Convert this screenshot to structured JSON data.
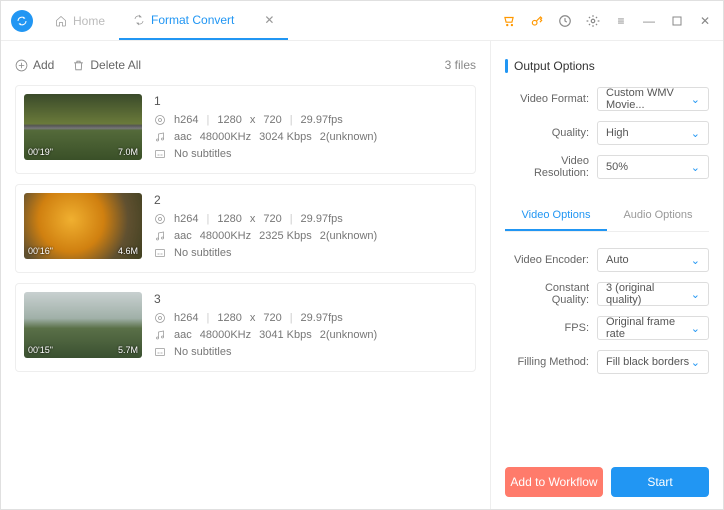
{
  "tabs": {
    "home": "Home",
    "active": "Format Convert"
  },
  "toolbar": {
    "add": "Add",
    "delete_all": "Delete All",
    "file_count": "3 files"
  },
  "files": [
    {
      "index": "1",
      "duration": "00'19\"",
      "size": "7.0M",
      "vcodec": "h264",
      "w": "1280",
      "x": "x",
      "h": "720",
      "fps": "29.97fps",
      "acodec": "aac",
      "arate": "48000KHz",
      "bitrate": "3024 Kbps",
      "ch": "2(unknown)",
      "subs": "No subtitles"
    },
    {
      "index": "2",
      "duration": "00'16\"",
      "size": "4.6M",
      "vcodec": "h264",
      "w": "1280",
      "x": "x",
      "h": "720",
      "fps": "29.97fps",
      "acodec": "aac",
      "arate": "48000KHz",
      "bitrate": "2325 Kbps",
      "ch": "2(unknown)",
      "subs": "No subtitles"
    },
    {
      "index": "3",
      "duration": "00'15\"",
      "size": "5.7M",
      "vcodec": "h264",
      "w": "1280",
      "x": "x",
      "h": "720",
      "fps": "29.97fps",
      "acodec": "aac",
      "arate": "48000KHz",
      "bitrate": "3041 Kbps",
      "ch": "2(unknown)",
      "subs": "No subtitles"
    }
  ],
  "output": {
    "title": "Output Options",
    "labels": {
      "video_format": "Video Format:",
      "quality": "Quality:",
      "resolution": "Video Resolution:"
    },
    "values": {
      "video_format": "Custom WMV Movie...",
      "quality": "High",
      "resolution": "50%"
    }
  },
  "opt_tabs": {
    "video": "Video Options",
    "audio": "Audio Options"
  },
  "video_opts": {
    "labels": {
      "encoder": "Video Encoder:",
      "cq": "Constant Quality:",
      "fps": "FPS:",
      "fill": "Filling Method:"
    },
    "values": {
      "encoder": "Auto",
      "cq": "3 (original quality)",
      "fps": "Original frame rate",
      "fill": "Fill black borders"
    }
  },
  "buttons": {
    "workflow": "Add to Workflow",
    "start": "Start"
  }
}
